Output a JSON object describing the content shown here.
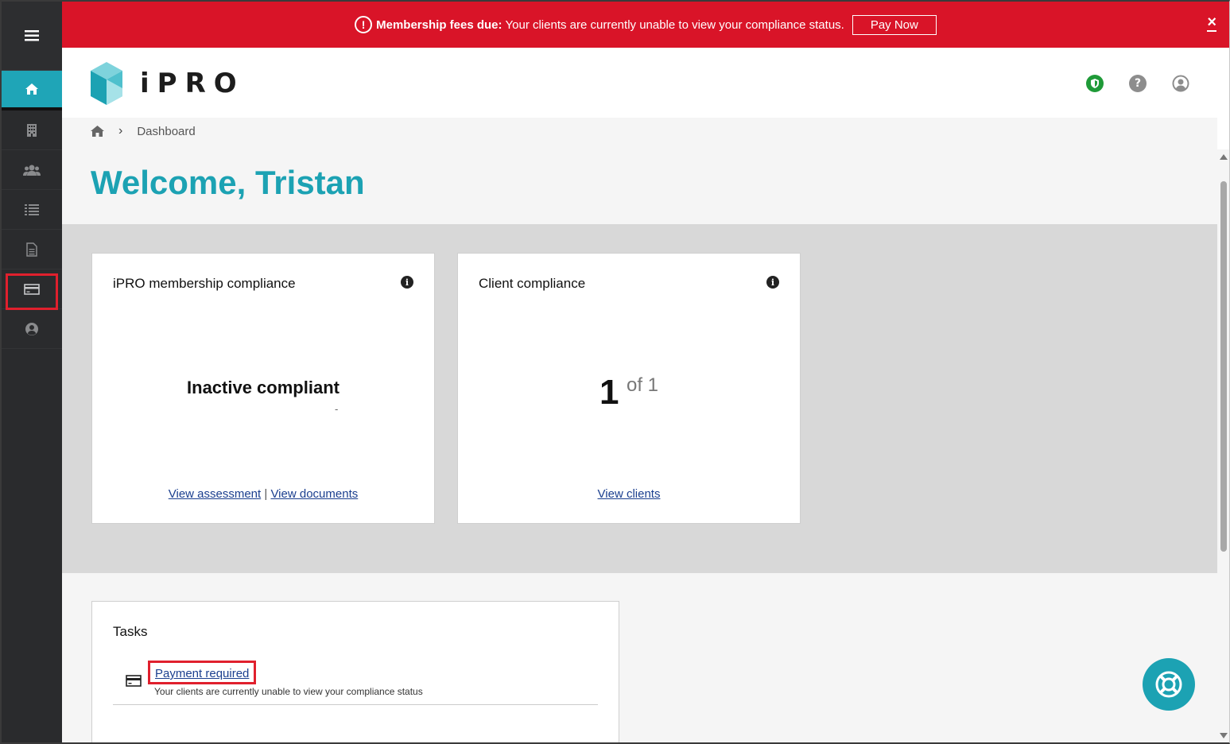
{
  "sidebar": {
    "items": [
      {
        "name": "menu-icon"
      },
      {
        "name": "home-icon",
        "active": true
      },
      {
        "name": "building-icon"
      },
      {
        "name": "users-icon"
      },
      {
        "name": "list-icon"
      },
      {
        "name": "document-icon"
      },
      {
        "name": "credit-card-icon",
        "highlighted": true
      },
      {
        "name": "user-circle-icon"
      }
    ]
  },
  "banner": {
    "title": "Membership fees due:",
    "message": "Your clients are currently unable to view your compliance status.",
    "button": "Pay Now",
    "close": "×",
    "color": "#d91428"
  },
  "header": {
    "logo_text": "iPRO",
    "icons": [
      "shield-icon",
      "help-icon",
      "account-icon"
    ]
  },
  "breadcrumb": {
    "current": "Dashboard"
  },
  "welcome": "Welcome, Tristan",
  "cards": {
    "membership": {
      "title": "iPRO membership compliance",
      "status": "Inactive compliant",
      "sub": "-",
      "link1": "View assessment",
      "separator": "|",
      "link2": "View documents"
    },
    "client": {
      "title": "Client compliance",
      "count": "1",
      "of": "of 1",
      "link": "View clients"
    }
  },
  "tasks": {
    "title": "Tasks",
    "items": [
      {
        "label": "Payment required",
        "description": "Your clients are currently unable to view your compliance status"
      }
    ]
  },
  "colors": {
    "accent": "#1ca2b3",
    "sidebar": "#2a2b2d",
    "highlight": "#e0202d",
    "link": "#1b3f8f"
  }
}
